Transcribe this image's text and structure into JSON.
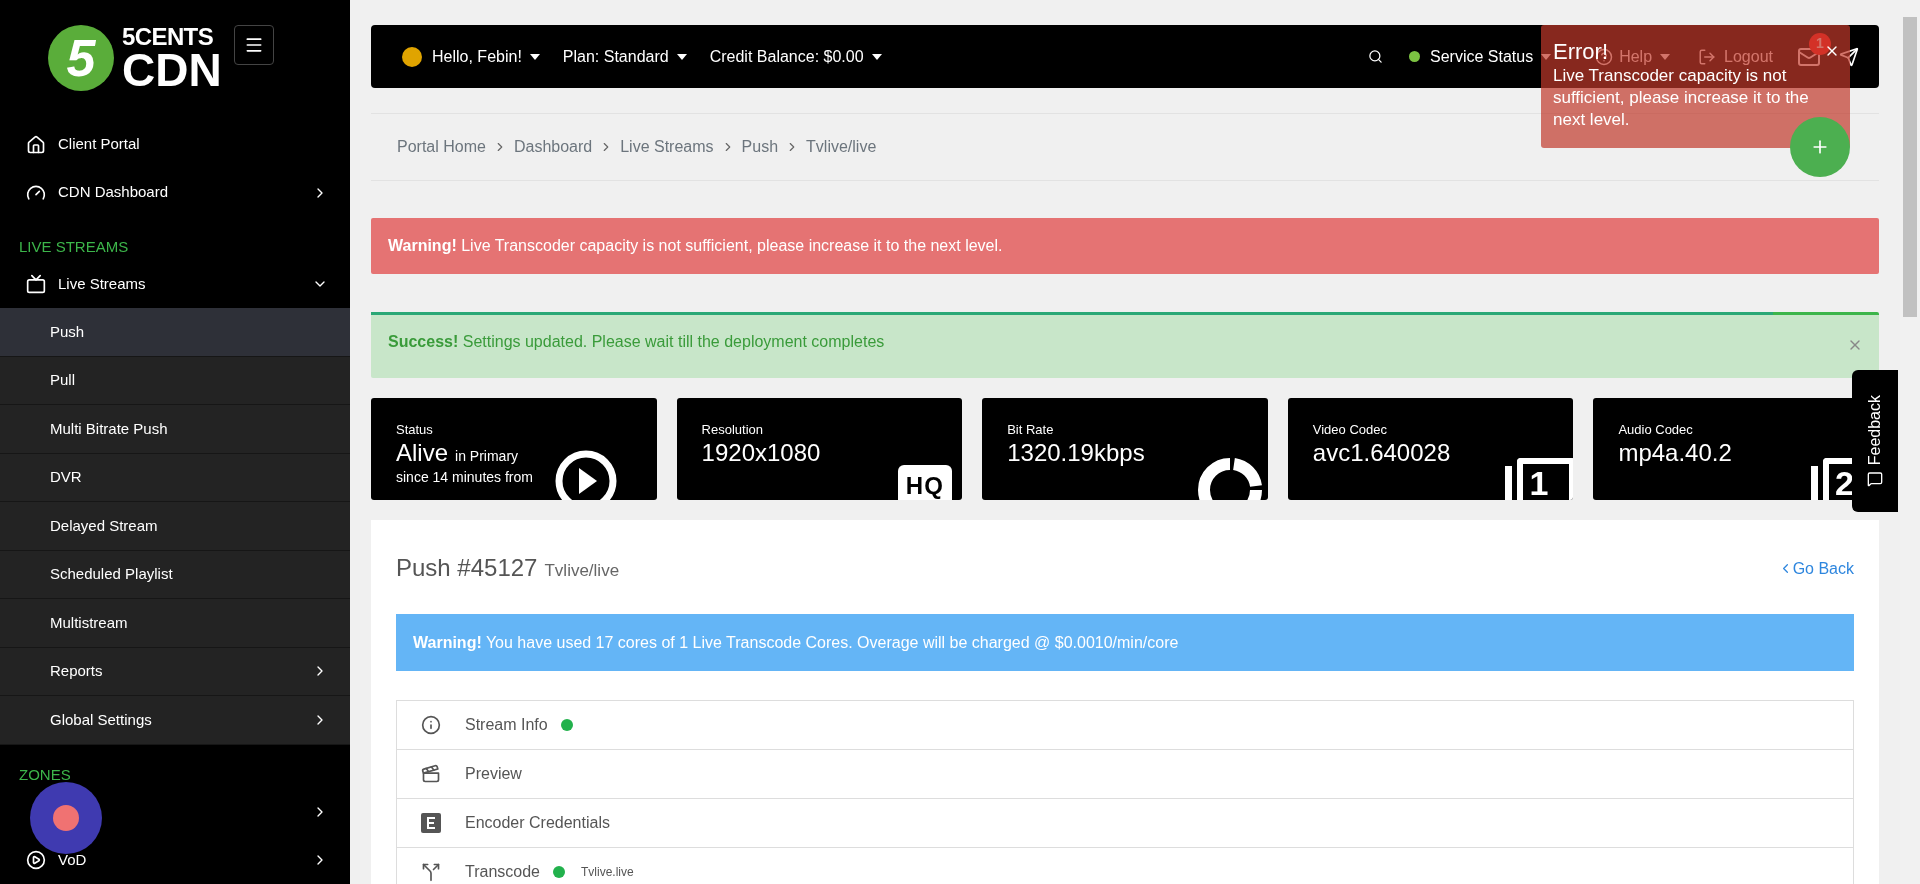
{
  "sidebar": {
    "logo": {
      "mark": "5",
      "top": "5CENTS",
      "bottom": "CDN"
    },
    "items": [
      {
        "kind": "link",
        "label": "Client Portal"
      },
      {
        "kind": "group",
        "label": "CDN Dashboard",
        "expanded": false
      },
      {
        "kind": "heading",
        "label": "LIVE STREAMS"
      },
      {
        "kind": "group",
        "label": "Live Streams",
        "expanded": true,
        "children": [
          {
            "label": "Push",
            "selected": true
          },
          {
            "label": "Pull",
            "selected": false
          },
          {
            "label": "Multi Bitrate Push",
            "selected": false
          },
          {
            "label": "DVR",
            "selected": false
          },
          {
            "label": "Delayed Stream",
            "selected": false
          },
          {
            "label": "Scheduled Playlist",
            "selected": false
          },
          {
            "label": "Multistream",
            "selected": false
          },
          {
            "label": "Reports",
            "selected": false,
            "expanded": false
          },
          {
            "label": "Global Settings",
            "selected": false,
            "expanded": false
          }
        ]
      },
      {
        "kind": "heading",
        "label": "ZONES"
      },
      {
        "kind": "group",
        "expanded": false
      },
      {
        "kind": "group",
        "label": "VoD",
        "expanded": false
      }
    ]
  },
  "header": {
    "greeting": "Hello, Febin!",
    "plan": "Plan: Standard",
    "credit": "Credit Balance: $0.00",
    "service_status": {
      "label": "Service Status",
      "color": "#7cc242"
    },
    "help": "Help",
    "logout": "Logout",
    "mail_count": "1"
  },
  "toast": {
    "title": "Error!",
    "message": "Live Transcoder capacity is not sufficient, please increase it to the next level."
  },
  "breadcrumb": [
    "Portal Home",
    "Dashboard",
    "Live Streams",
    "Push",
    "Tvlive/live"
  ],
  "alerts": [
    {
      "kind": "danger",
      "text": "**Warning!** Live Transcoder capacity is not sufficient, please increase it to the next level."
    },
    {
      "kind": "success",
      "text": "**Success!** Settings updated. Please wait till the deployment completes",
      "level": 0.93
    }
  ],
  "stats": [
    {
      "kind": "play",
      "label": "Status",
      "value": "Alive",
      "suffix": "in Primary",
      "note": "since 14 minutes from"
    },
    {
      "kind": "badge",
      "label": "Resolution",
      "value": "1920x1080",
      "badge": "HQ"
    },
    {
      "kind": "ring",
      "label": "Bit Rate",
      "value": "1320.19kbps"
    },
    {
      "kind": "boxed",
      "label": "Video Codec",
      "value": "avc1.640028",
      "badge": "1"
    },
    {
      "kind": "boxed",
      "label": "Audio Codec",
      "value": "mp4a.40.2",
      "badge": "2"
    }
  ],
  "panel": {
    "title": "Push #45127",
    "subtitle": "Tvlive/live",
    "back": "Go Back",
    "notice": "**Warning!** You have used 17 cores of 1 Live Transcode Cores. Overage will be charged @ $0.0010/min/core",
    "sections": [
      {
        "label": "Stream Info",
        "color": "#22b14c"
      },
      {
        "label": "Preview"
      },
      {
        "label": "Encoder Credentials"
      },
      {
        "label": "Transcode",
        "color": "#22b14c",
        "note": "Tvlive.live"
      }
    ]
  },
  "feedback": "Feedback"
}
